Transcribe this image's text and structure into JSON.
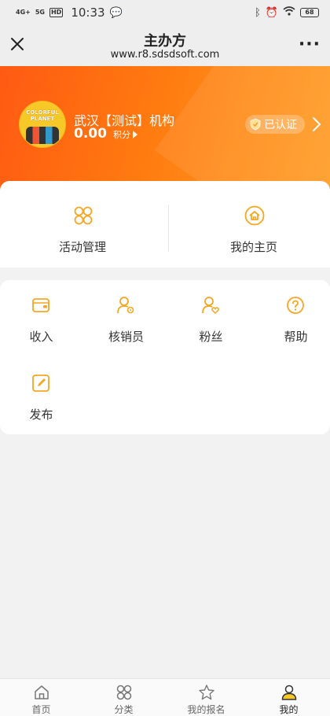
{
  "status_bar": {
    "network1": "4G+",
    "network2": "5G",
    "hd": "HD",
    "time": "10:33",
    "battery": "68"
  },
  "nav": {
    "title": "主办方",
    "url": "www.r8.sdsdsoft.com"
  },
  "profile": {
    "avatar_text": "COLORFUL PLANET",
    "org_name": "武汉【测试】机构",
    "points_value": "0.00",
    "points_label": "积分",
    "verified_label": "已认证"
  },
  "quick_actions": [
    {
      "label": "活动管理",
      "icon": "grid-icon"
    },
    {
      "label": "我的主页",
      "icon": "home-icon"
    }
  ],
  "tools": [
    {
      "label": "收入",
      "icon": "wallet-icon"
    },
    {
      "label": "核销员",
      "icon": "user-settings-icon"
    },
    {
      "label": "粉丝",
      "icon": "user-heart-icon"
    },
    {
      "label": "帮助",
      "icon": "help-icon"
    },
    {
      "label": "发布",
      "icon": "edit-icon"
    }
  ],
  "tabs": [
    {
      "label": "首页",
      "icon": "home-icon"
    },
    {
      "label": "分类",
      "icon": "grid-icon"
    },
    {
      "label": "我的报名",
      "icon": "star-icon"
    },
    {
      "label": "我的",
      "icon": "user-icon"
    }
  ],
  "colors": {
    "accent": "#f5a623",
    "banner_start": "#ff5a12",
    "banner_end": "#ff9d25"
  }
}
